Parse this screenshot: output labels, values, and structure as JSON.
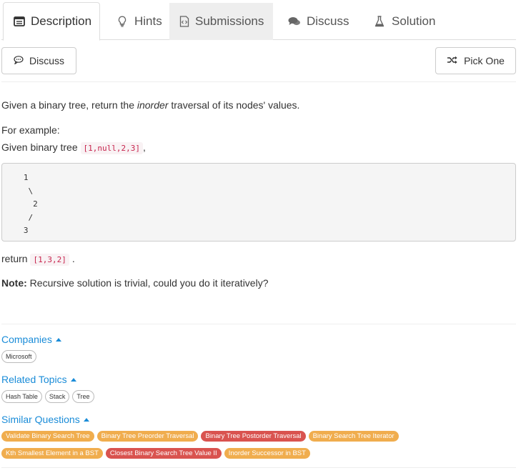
{
  "tabs": [
    {
      "label": "Description",
      "icon": "description-icon"
    },
    {
      "label": "Hints",
      "icon": "lightbulb-icon"
    },
    {
      "label": "Submissions",
      "icon": "code-file-icon"
    },
    {
      "label": "Discuss",
      "icon": "comments-icon"
    },
    {
      "label": "Solution",
      "icon": "flask-icon"
    }
  ],
  "toolbar": {
    "discuss_label": "Discuss",
    "pick_one_label": "Pick One"
  },
  "problem": {
    "intro_prefix": "Given a binary tree, return the ",
    "intro_emphasis": "inorder",
    "intro_suffix": " traversal of its nodes' values.",
    "example_label": "For example:",
    "given_prefix": "Given binary tree ",
    "given_code": "[1,null,2,3]",
    "given_suffix": ",",
    "tree_block": "   1\n    \\\n     2\n    /\n   3",
    "return_prefix": "return ",
    "return_code": "[1,3,2]",
    "return_suffix": ".",
    "note_label": "Note:",
    "note_text": " Recursive solution is trivial, could you do it iteratively?"
  },
  "companies": {
    "title": "Companies",
    "items": [
      "Microsoft"
    ]
  },
  "related_topics": {
    "title": "Related Topics",
    "items": [
      "Hash Table",
      "Stack",
      "Tree"
    ]
  },
  "similar_questions": {
    "title": "Similar Questions",
    "rows": [
      [
        {
          "label": "Validate Binary Search Tree",
          "difficulty": "medium"
        },
        {
          "label": "Binary Tree Preorder Traversal",
          "difficulty": "medium"
        },
        {
          "label": "Binary Tree Postorder Traversal",
          "difficulty": "hard"
        },
        {
          "label": "Binary Search Tree Iterator",
          "difficulty": "medium"
        }
      ],
      [
        {
          "label": "Kth Smallest Element in a BST",
          "difficulty": "medium"
        },
        {
          "label": "Closest Binary Search Tree Value II",
          "difficulty": "hard"
        },
        {
          "label": "Inorder Successor in BST",
          "difficulty": "medium"
        }
      ]
    ]
  },
  "colors": {
    "medium": "#f0ad4e",
    "hard": "#d9534f",
    "link": "#1a8cd8"
  }
}
